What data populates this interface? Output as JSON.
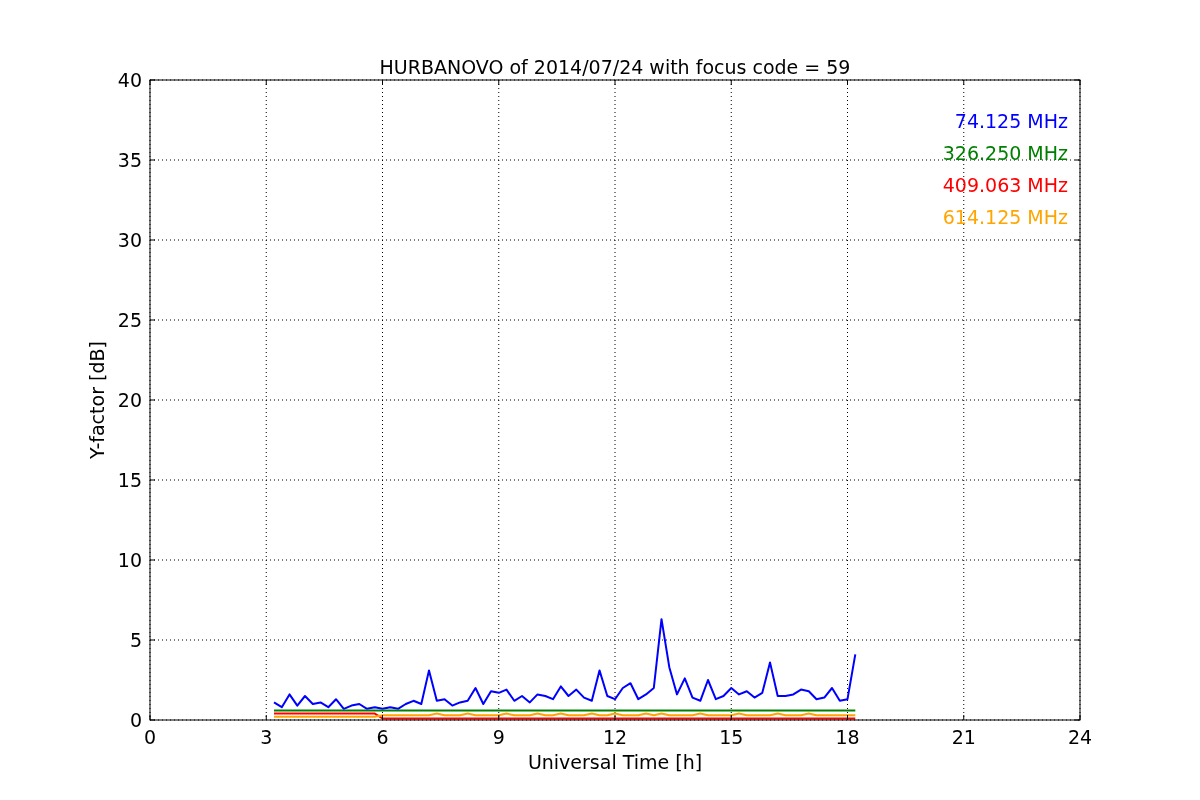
{
  "chart_data": {
    "type": "line",
    "title": "HURBANOVO of 2014/07/24 with focus code = 59",
    "xlabel": "Universal Time [h]",
    "ylabel": "Y-factor [dB]",
    "xlim": [
      0,
      24
    ],
    "ylim": [
      0,
      40
    ],
    "grid": true,
    "xticks": [
      0,
      3,
      6,
      9,
      12,
      15,
      18,
      21,
      24
    ],
    "yticks": [
      0,
      5,
      10,
      15,
      20,
      25,
      30,
      35,
      40
    ],
    "x": [
      3.2,
      3.4,
      3.6,
      3.8,
      4.0,
      4.2,
      4.4,
      4.6,
      4.8,
      5.0,
      5.2,
      5.4,
      5.6,
      5.8,
      6.0,
      6.2,
      6.4,
      6.6,
      6.8,
      7.0,
      7.2,
      7.4,
      7.6,
      7.8,
      8.0,
      8.2,
      8.4,
      8.6,
      8.8,
      9.0,
      9.2,
      9.4,
      9.6,
      9.8,
      10.0,
      10.2,
      10.4,
      10.6,
      10.8,
      11.0,
      11.2,
      11.4,
      11.6,
      11.8,
      12.0,
      12.2,
      12.4,
      12.6,
      12.8,
      13.0,
      13.2,
      13.4,
      13.6,
      13.8,
      14.0,
      14.2,
      14.4,
      14.6,
      14.8,
      15.0,
      15.2,
      15.4,
      15.6,
      15.8,
      16.0,
      16.2,
      16.4,
      16.6,
      16.8,
      17.0,
      17.2,
      17.4,
      17.6,
      17.8,
      18.0,
      18.2
    ],
    "series": [
      {
        "name": "74.125 MHz",
        "color": "#0000ff",
        "values": [
          1.1,
          0.8,
          1.6,
          0.9,
          1.5,
          1.0,
          1.1,
          0.8,
          1.3,
          0.7,
          0.9,
          1.0,
          0.7,
          0.8,
          0.7,
          0.8,
          0.7,
          1.0,
          1.2,
          1.0,
          3.1,
          1.2,
          1.3,
          0.9,
          1.1,
          1.2,
          2.0,
          1.0,
          1.8,
          1.7,
          1.9,
          1.2,
          1.5,
          1.1,
          1.6,
          1.5,
          1.3,
          2.1,
          1.5,
          1.9,
          1.4,
          1.2,
          3.1,
          1.5,
          1.3,
          2.0,
          2.3,
          1.3,
          1.6,
          2.0,
          6.3,
          3.3,
          1.6,
          2.6,
          1.4,
          1.2,
          2.5,
          1.3,
          1.5,
          2.0,
          1.6,
          1.8,
          1.4,
          1.7,
          3.6,
          1.5,
          1.5,
          1.6,
          1.9,
          1.8,
          1.3,
          1.4,
          2.0,
          1.2,
          1.3,
          4.1
        ]
      },
      {
        "name": "326.250 MHz",
        "color": "#008000",
        "values": [
          0.6,
          0.6,
          0.6,
          0.6,
          0.6,
          0.6,
          0.6,
          0.6,
          0.6,
          0.6,
          0.6,
          0.6,
          0.6,
          0.6,
          0.6,
          0.6,
          0.6,
          0.6,
          0.6,
          0.6,
          0.6,
          0.6,
          0.6,
          0.6,
          0.6,
          0.6,
          0.6,
          0.6,
          0.6,
          0.6,
          0.6,
          0.6,
          0.6,
          0.6,
          0.6,
          0.6,
          0.6,
          0.6,
          0.6,
          0.6,
          0.6,
          0.6,
          0.6,
          0.6,
          0.6,
          0.6,
          0.6,
          0.6,
          0.6,
          0.6,
          0.6,
          0.6,
          0.6,
          0.6,
          0.6,
          0.6,
          0.6,
          0.6,
          0.6,
          0.6,
          0.6,
          0.6,
          0.6,
          0.6,
          0.6,
          0.6,
          0.6,
          0.6,
          0.6,
          0.6,
          0.6,
          0.6,
          0.6,
          0.6,
          0.6,
          0.6
        ]
      },
      {
        "name": "409.063 MHz",
        "color": "#ff0000",
        "values": [
          0.4,
          0.4,
          0.4,
          0.4,
          0.4,
          0.4,
          0.4,
          0.4,
          0.4,
          0.4,
          0.4,
          0.4,
          0.4,
          0.4,
          0.1,
          0.1,
          0.1,
          0.1,
          0.1,
          0.1,
          0.1,
          0.1,
          0.1,
          0.1,
          0.1,
          0.1,
          0.1,
          0.1,
          0.1,
          0.1,
          0.1,
          0.1,
          0.1,
          0.1,
          0.1,
          0.1,
          0.1,
          0.1,
          0.1,
          0.1,
          0.1,
          0.1,
          0.1,
          0.1,
          0.1,
          0.1,
          0.1,
          0.1,
          0.1,
          0.1,
          0.1,
          0.1,
          0.1,
          0.1,
          0.1,
          0.1,
          0.1,
          0.1,
          0.1,
          0.1,
          0.1,
          0.1,
          0.1,
          0.1,
          0.1,
          0.1,
          0.1,
          0.1,
          0.1,
          0.1,
          0.1,
          0.1,
          0.1,
          0.1,
          0.1,
          0.1
        ]
      },
      {
        "name": "614.125 MHz",
        "color": "#ffa500",
        "values": [
          0.2,
          0.2,
          0.2,
          0.2,
          0.2,
          0.2,
          0.2,
          0.2,
          0.2,
          0.2,
          0.2,
          0.2,
          0.2,
          0.2,
          0.3,
          0.3,
          0.3,
          0.3,
          0.3,
          0.3,
          0.3,
          0.4,
          0.3,
          0.3,
          0.3,
          0.4,
          0.3,
          0.3,
          0.3,
          0.3,
          0.4,
          0.3,
          0.3,
          0.3,
          0.4,
          0.3,
          0.3,
          0.4,
          0.3,
          0.3,
          0.3,
          0.4,
          0.3,
          0.3,
          0.4,
          0.3,
          0.3,
          0.3,
          0.4,
          0.3,
          0.4,
          0.3,
          0.3,
          0.3,
          0.3,
          0.4,
          0.3,
          0.3,
          0.3,
          0.3,
          0.4,
          0.3,
          0.3,
          0.3,
          0.3,
          0.4,
          0.3,
          0.3,
          0.3,
          0.4,
          0.3,
          0.3,
          0.3,
          0.3,
          0.3,
          0.3
        ]
      }
    ]
  }
}
